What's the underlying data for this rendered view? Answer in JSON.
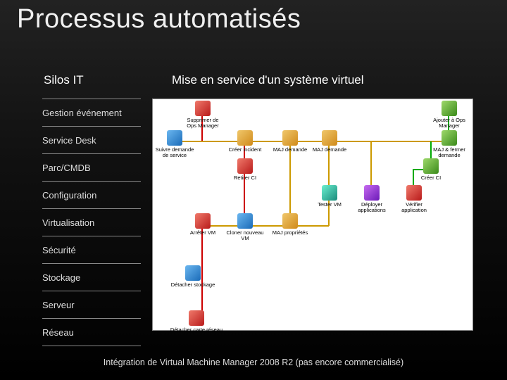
{
  "title": "Processus automatisés",
  "columns": {
    "left": "Silos IT",
    "right": "Mise en service d'un système virtuel"
  },
  "sidebar": [
    "Gestion événement",
    "Service Desk",
    "Parc/CMDB",
    "Configuration",
    "Virtualisation",
    "Sécurité",
    "Stockage",
    "Serveur",
    "Réseau"
  ],
  "nodes": {
    "supprimer": {
      "label": "Supprimer de Ops Manager"
    },
    "ajouter": {
      "label": "Ajouter à Ops Manager"
    },
    "suivre": {
      "label": "Suivre demande de service"
    },
    "creer_inc": {
      "label": "Créer incident"
    },
    "maj_dem1": {
      "label": "MAJ demande"
    },
    "maj_dem2": {
      "label": "MAJ demande"
    },
    "maj_fermer": {
      "label": "MAJ & fermer demande"
    },
    "retirer_ci": {
      "label": "Retirer CI"
    },
    "creer_ci": {
      "label": "Créer CI"
    },
    "tester_vm": {
      "label": "Tester VM"
    },
    "deployer": {
      "label": "Déployer applications"
    },
    "verifier": {
      "label": "Vérifier application"
    },
    "arreter": {
      "label": "Arrêter VM"
    },
    "cloner": {
      "label": "Cloner nouveau VM"
    },
    "maj_prop": {
      "label": "MAJ propriétés"
    },
    "detach_stk": {
      "label": "Détacher stockage"
    },
    "detach_net": {
      "label": "Détacher carte réseau"
    }
  },
  "footer": "Intégration de Virtual Machine Manager  2008 R2 (pas encore commercialisé)"
}
